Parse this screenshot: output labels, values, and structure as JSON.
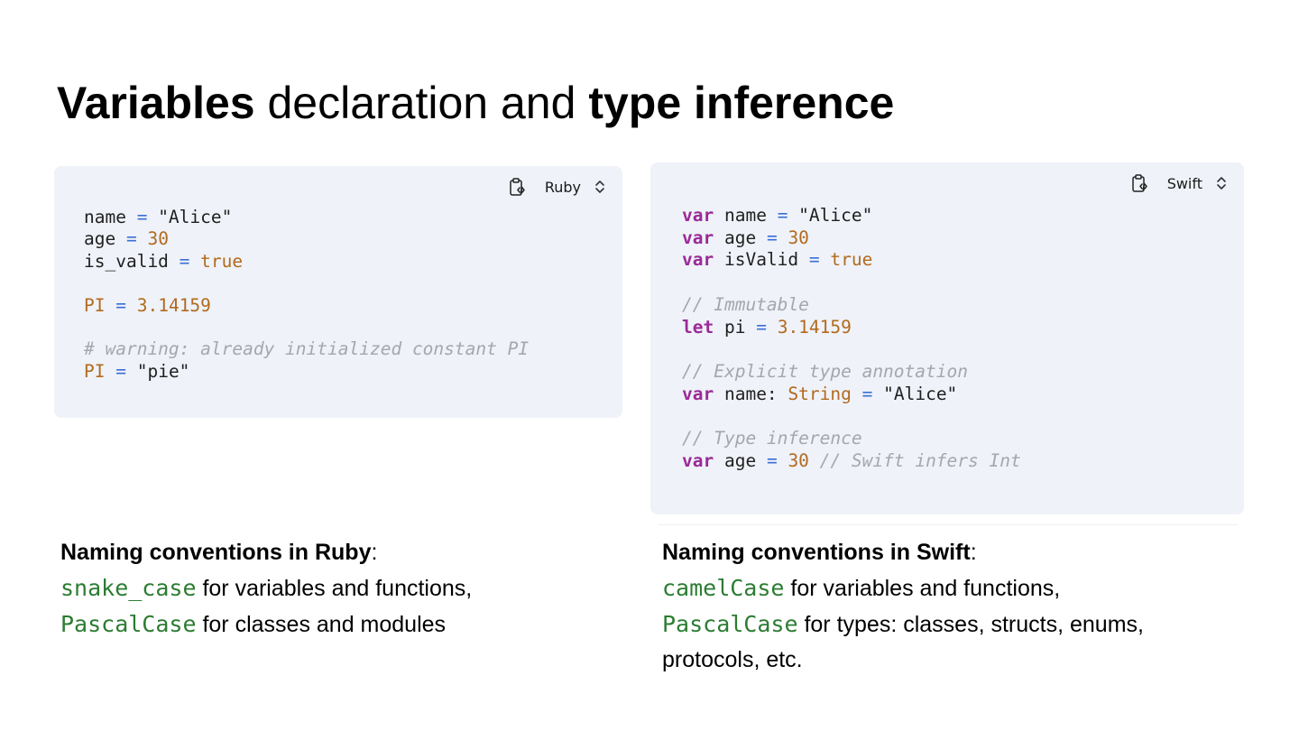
{
  "title": {
    "part1": "Variables",
    "part2": " declaration and ",
    "part3": "type inference"
  },
  "ruby_panel": {
    "language": "Ruby",
    "lines": [
      [
        {
          "t": "name ",
          "c": "id"
        },
        {
          "t": "=",
          "c": "op"
        },
        {
          "t": " \"Alice\"",
          "c": "str"
        }
      ],
      [
        {
          "t": "age ",
          "c": "id"
        },
        {
          "t": "=",
          "c": "op"
        },
        {
          "t": " ",
          "c": "id"
        },
        {
          "t": "30",
          "c": "num"
        }
      ],
      [
        {
          "t": "is_valid ",
          "c": "id"
        },
        {
          "t": "=",
          "c": "op"
        },
        {
          "t": " ",
          "c": "id"
        },
        {
          "t": "true",
          "c": "num"
        }
      ],
      [],
      [
        {
          "t": "PI",
          "c": "num"
        },
        {
          "t": " ",
          "c": "id"
        },
        {
          "t": "=",
          "c": "op"
        },
        {
          "t": " ",
          "c": "id"
        },
        {
          "t": "3.14159",
          "c": "num"
        }
      ],
      [],
      [
        {
          "t": "# warning: already initialized constant PI",
          "c": "cm"
        }
      ],
      [
        {
          "t": "PI",
          "c": "num"
        },
        {
          "t": " ",
          "c": "id"
        },
        {
          "t": "=",
          "c": "op"
        },
        {
          "t": " \"pie\"",
          "c": "str"
        }
      ]
    ]
  },
  "swift_panel": {
    "language": "Swift",
    "lines": [
      [
        {
          "t": "var",
          "c": "kw"
        },
        {
          "t": " name ",
          "c": "id"
        },
        {
          "t": "=",
          "c": "op"
        },
        {
          "t": " \"Alice\"",
          "c": "str"
        }
      ],
      [
        {
          "t": "var",
          "c": "kw"
        },
        {
          "t": " age ",
          "c": "id"
        },
        {
          "t": "=",
          "c": "op"
        },
        {
          "t": " ",
          "c": "id"
        },
        {
          "t": "30",
          "c": "num"
        }
      ],
      [
        {
          "t": "var",
          "c": "kw"
        },
        {
          "t": " isValid ",
          "c": "id"
        },
        {
          "t": "=",
          "c": "op"
        },
        {
          "t": " ",
          "c": "id"
        },
        {
          "t": "true",
          "c": "num"
        }
      ],
      [],
      [
        {
          "t": "// Immutable",
          "c": "cm"
        }
      ],
      [
        {
          "t": "let",
          "c": "kw"
        },
        {
          "t": " pi ",
          "c": "id"
        },
        {
          "t": "=",
          "c": "op"
        },
        {
          "t": " ",
          "c": "id"
        },
        {
          "t": "3.14159",
          "c": "num"
        }
      ],
      [],
      [
        {
          "t": "// Explicit type annotation",
          "c": "cm"
        }
      ],
      [
        {
          "t": "var",
          "c": "kw"
        },
        {
          "t": " name: ",
          "c": "id"
        },
        {
          "t": "String",
          "c": "num"
        },
        {
          "t": " ",
          "c": "id"
        },
        {
          "t": "=",
          "c": "op"
        },
        {
          "t": " \"Alice\"",
          "c": "str"
        }
      ],
      [],
      [
        {
          "t": "// Type inference",
          "c": "cm"
        }
      ],
      [
        {
          "t": "var",
          "c": "kw"
        },
        {
          "t": " age ",
          "c": "id"
        },
        {
          "t": "=",
          "c": "op"
        },
        {
          "t": " ",
          "c": "id"
        },
        {
          "t": "30",
          "c": "num"
        },
        {
          "t": " ",
          "c": "id"
        },
        {
          "t": "// Swift infers Int",
          "c": "cm"
        }
      ]
    ]
  },
  "ruby_notes": {
    "heading": "Naming conventions in Ruby",
    "colon": ":",
    "rule1_code": "snake_case",
    "rule1_text": " for variables and functions,",
    "rule2_code": "PascalCase",
    "rule2_text": " for classes and modules"
  },
  "swift_notes": {
    "heading": "Naming conventions in Swift",
    "colon": ":",
    "rule1_code": "camelCase",
    "rule1_text": " for variables and functions,",
    "rule2_code": "PascalCase",
    "rule2_text": " for types: classes, structs, enums, protocols, etc."
  },
  "icons": {
    "copy": "clipboard-code-icon",
    "language_select": "chevron-up-down-icon"
  },
  "colors": {
    "panel_bg": "#eff2f8",
    "keyword": "#9b2a98",
    "operator": "#3a6fd6",
    "literal": "#b26a1f",
    "comment": "#a4a7ad",
    "convention_code": "#2c7c32"
  }
}
